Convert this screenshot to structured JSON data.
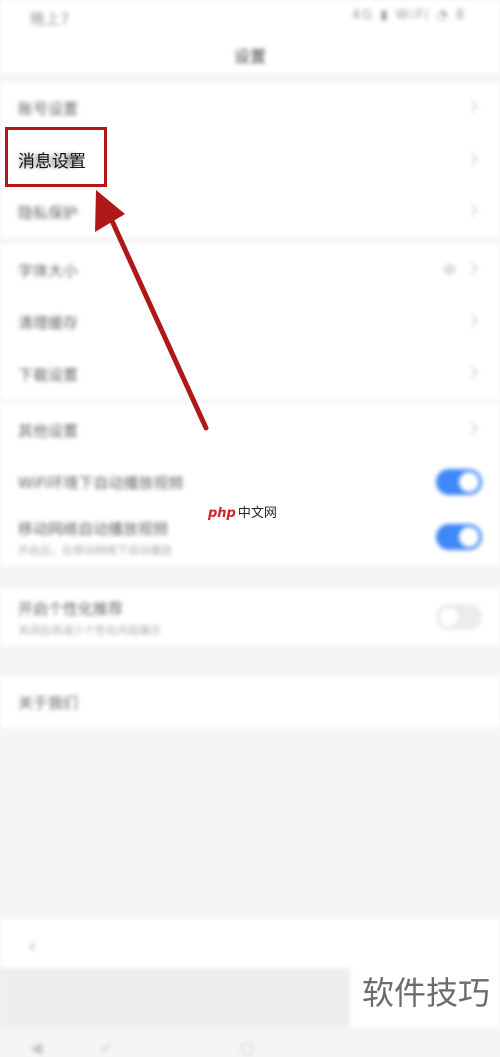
{
  "status_bar": {
    "time": "晚上7",
    "indicators": "4G ▮ WiFi ◔ 8"
  },
  "header": {
    "title": "设置"
  },
  "groups": {
    "g1": [
      {
        "label": "账号设置"
      },
      {
        "label": "消息设置"
      },
      {
        "label": "隐私保护"
      }
    ],
    "g2": [
      {
        "label": "字体大小",
        "value": "中"
      },
      {
        "label": "清理缓存"
      },
      {
        "label": "下载设置"
      }
    ],
    "g3": [
      {
        "label": "其他设置"
      },
      {
        "label": "WiFi环境下自动播放视频",
        "toggle": "on"
      },
      {
        "label": "移动网络自动播放视频",
        "sub": "开启后，在移动网络下自动播放",
        "toggle": "on"
      }
    ],
    "g4": [
      {
        "label": "开启个性化推荐",
        "sub": "关闭后将减少个性化内容展示",
        "toggle": "off"
      }
    ],
    "g5": [
      {
        "label": "关于我们"
      }
    ]
  },
  "highlight": {
    "label": "消息设置",
    "color": "#b01818"
  },
  "watermark": {
    "php": "php",
    "text": "中文网"
  },
  "corner_watermark": "软件技巧",
  "bottom": {
    "back": "‹"
  },
  "colors": {
    "toggle_on": "#3f88f7",
    "annotation": "#b01818"
  }
}
